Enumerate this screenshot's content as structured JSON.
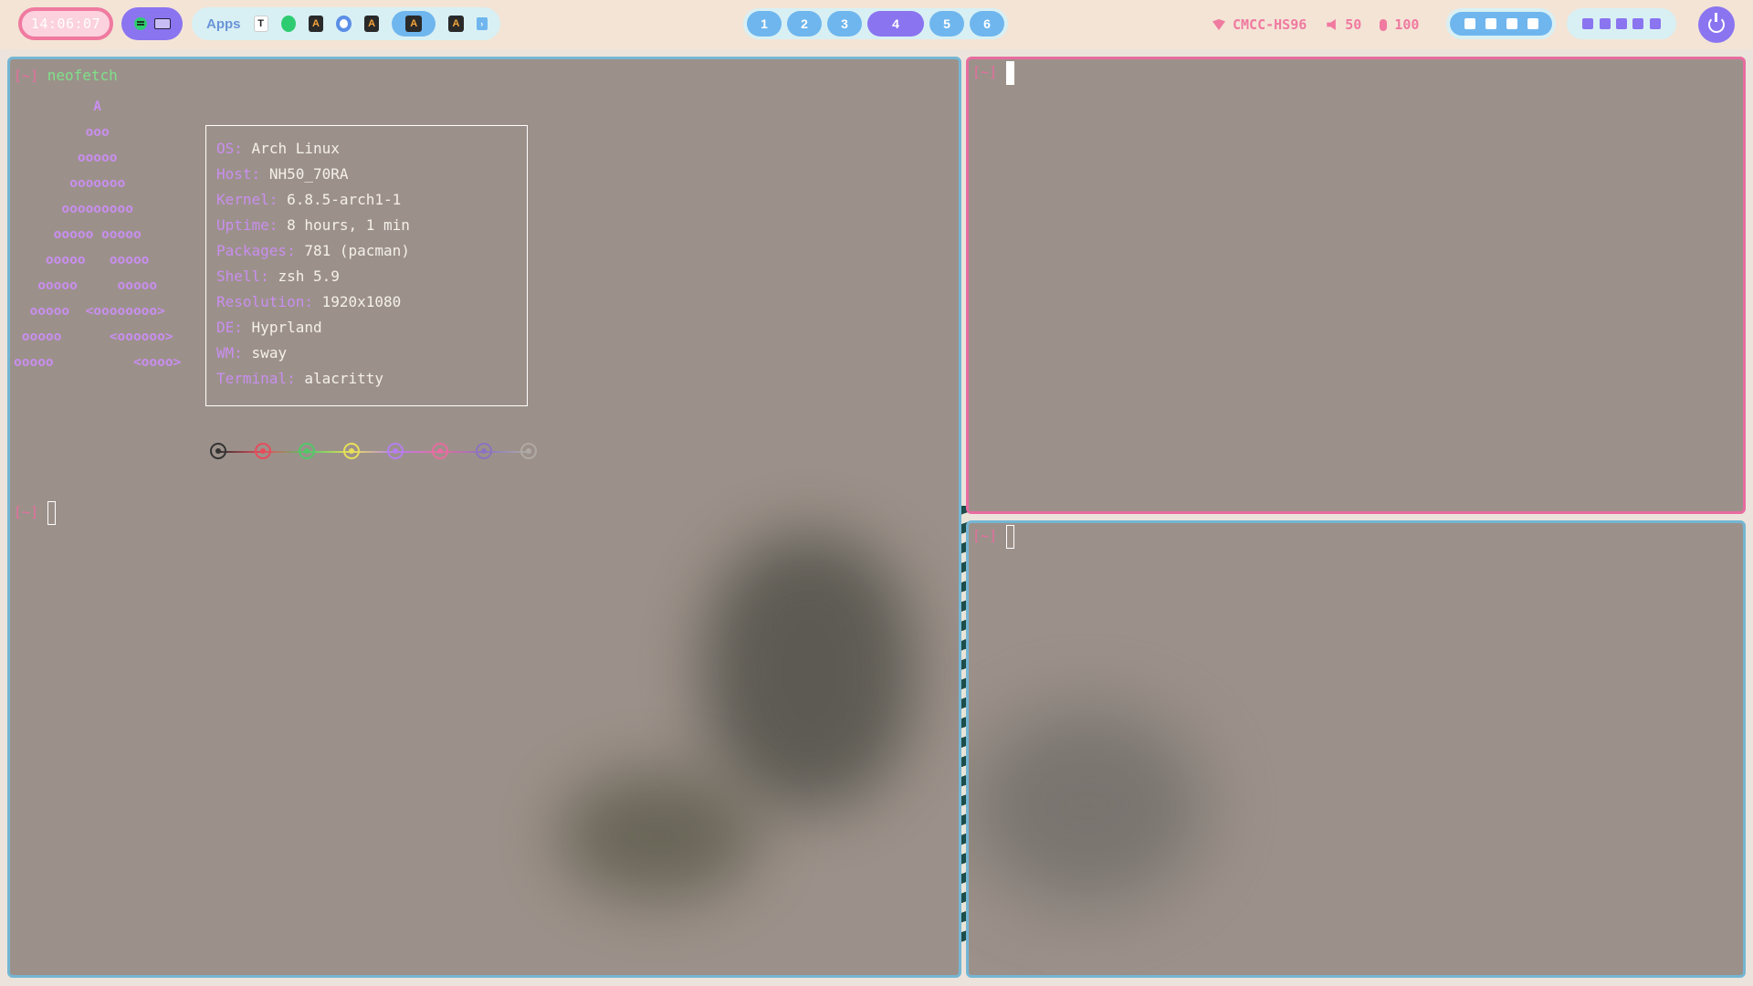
{
  "topbar": {
    "clock": "14:06:07",
    "apps_label": "Apps",
    "app_t_label": "T",
    "app_a_label": "A",
    "workspaces": [
      "1",
      "2",
      "3",
      "4",
      "5",
      "6"
    ],
    "active_workspace": "4",
    "network_name": "CMCC-HS96",
    "volume": "50",
    "mic": "100",
    "colors": {
      "accent_pink": "#f07aa0",
      "accent_purple": "#8a74f0",
      "accent_blue": "#6fb6ee"
    }
  },
  "windows": {
    "left": {
      "prompt": "[~]",
      "command": "neofetch",
      "ascii": [
        "          A",
        "         ooo",
        "        ooooo",
        "       ooooooo",
        "      ooooooooo",
        "     ooooo ooooo",
        "    ooooo   ooooo",
        "   ooooo     ooooo",
        "  ooooo  <oooooooo>",
        " ooooo      <oooooo>",
        "ooooo          <oooo>"
      ],
      "info": [
        {
          "key": "OS",
          "value": "Arch Linux"
        },
        {
          "key": "Host",
          "value": "NH50_70RA"
        },
        {
          "key": "Kernel",
          "value": "6.8.5-arch1-1"
        },
        {
          "key": "Uptime",
          "value": "8 hours, 1 min"
        },
        {
          "key": "Packages",
          "value": "781 (pacman)"
        },
        {
          "key": "Shell",
          "value": "zsh 5.9"
        },
        {
          "key": "Resolution",
          "value": "1920x1080"
        },
        {
          "key": "DE",
          "value": "Hyprland"
        },
        {
          "key": "WM",
          "value": "sway"
        },
        {
          "key": "Terminal",
          "value": "alacritty"
        }
      ],
      "palette": [
        "#333333",
        "#e84c5c",
        "#52c86a",
        "#e8e05a",
        "#b47ef0",
        "#e86ca0",
        "#8a74c0",
        "#b0aaa4"
      ],
      "prompt2": "[~]"
    },
    "top_right": {
      "prompt": "[~]"
    },
    "bottom_right": {
      "prompt": "[~]"
    }
  }
}
